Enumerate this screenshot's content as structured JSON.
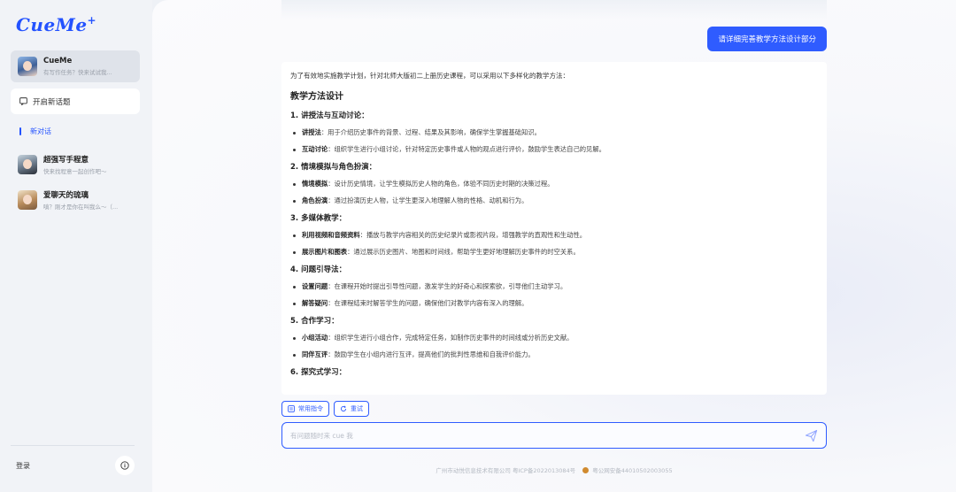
{
  "app": {
    "logo": "CueMe",
    "logo_mark": "+"
  },
  "sidebar": {
    "active_bot": {
      "name": "CueMe",
      "subtitle": "有写作任务？快来试试我..."
    },
    "new_topic_label": "开启新话题",
    "new_chat_label": "新对话",
    "bots": [
      {
        "name": "超强写手程意",
        "subtitle": "快来找程意一起创作吧～"
      },
      {
        "name": "爱聊天的琉璃",
        "subtitle": "嗔？刚才是你在叫我么～（..."
      }
    ],
    "login_label": "登录"
  },
  "chat": {
    "user_message": "请详细完善教学方法设计部分",
    "intro": "为了有效地实施教学计划，针对北师大版初二上册历史课程，可以采用以下多样化的教学方法：",
    "heading": "教学方法设计",
    "sections": [
      {
        "title": "1. 讲授法与互动讨论：",
        "items": [
          {
            "term": "讲授法",
            "text": "：用于介绍历史事件的背景、过程、结果及其影响，确保学生掌握基础知识。"
          },
          {
            "term": "互动讨论",
            "text": "：组织学生进行小组讨论，针对特定历史事件或人物的观点进行评价，鼓励学生表达自己的见解。"
          }
        ]
      },
      {
        "title": "2. 情境模拟与角色扮演：",
        "items": [
          {
            "term": "情境模拟",
            "text": "：设计历史情境，让学生模拟历史人物的角色，体验不同历史时期的决策过程。"
          },
          {
            "term": "角色扮演",
            "text": "：通过扮演历史人物，让学生更深入地理解人物的性格、动机和行为。"
          }
        ]
      },
      {
        "title": "3. 多媒体教学：",
        "items": [
          {
            "term": "利用视频和音频资料",
            "text": "：播放与教学内容相关的历史纪录片或影视片段，增强教学的直观性和生动性。"
          },
          {
            "term": "展示图片和图表",
            "text": "：通过展示历史图片、地图和时间线，帮助学生更好地理解历史事件的时空关系。"
          }
        ]
      },
      {
        "title": "4. 问题引导法：",
        "items": [
          {
            "term": "设置问题",
            "text": "：在课程开始时提出引导性问题，激发学生的好奇心和探索欲，引导他们主动学习。"
          },
          {
            "term": "解答疑问",
            "text": "：在课程结束时解答学生的问题，确保他们对教学内容有深入的理解。"
          }
        ]
      },
      {
        "title": "5. 合作学习：",
        "items": [
          {
            "term": "小组活动",
            "text": "：组织学生进行小组合作，完成特定任务，如制作历史事件的时间线或分析历史文献。"
          },
          {
            "term": "同伴互评",
            "text": "：鼓励学生在小组内进行互评，提高他们的批判性思维和自我评价能力。"
          }
        ]
      },
      {
        "title": "6. 探究式学习：",
        "items": []
      }
    ],
    "chips": {
      "commands": "常用指令",
      "retry": "重试"
    },
    "input_placeholder": "有问题随时来 cue 我"
  },
  "footer": {
    "company": "广州市动悦信息技术有限公司 粤ICP备2022013084号",
    "police": "粤公网安备44010502003055"
  },
  "colors": {
    "accent": "#2f5cff",
    "sidebar_bg": "#f1f3f7"
  }
}
